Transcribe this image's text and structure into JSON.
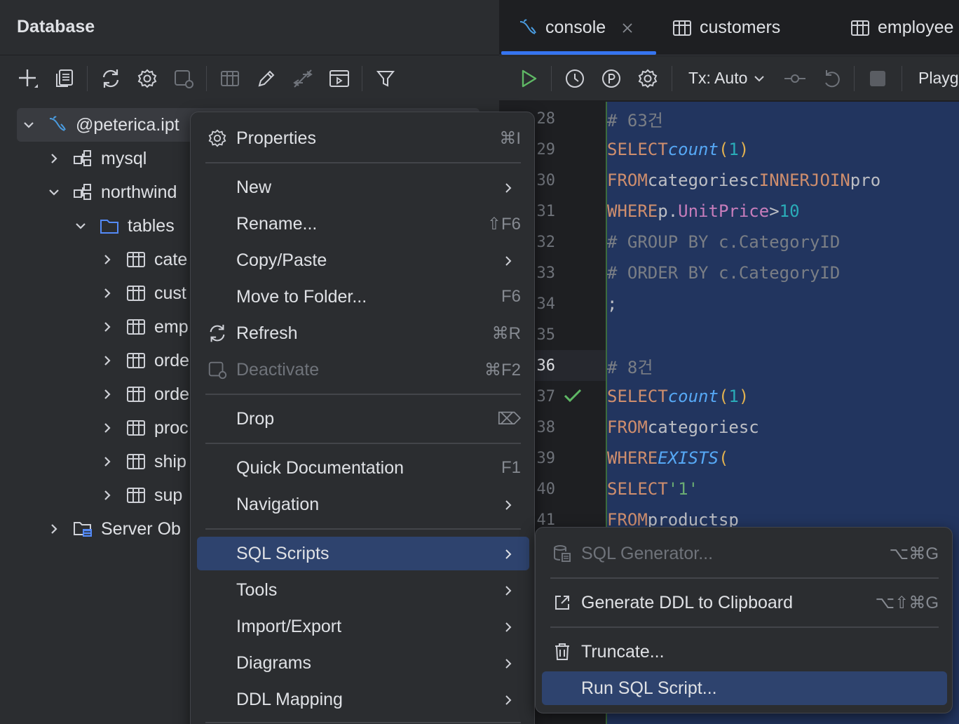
{
  "panel": {
    "title": "Database",
    "toolbar_icons": [
      "add-icon",
      "copy-icon",
      "refresh-icon",
      "settings-icon",
      "deactivate-icon",
      "table-icon",
      "edit-icon",
      "jump-icon",
      "console-icon",
      "filter-icon"
    ]
  },
  "tree": {
    "root": "@peterica.ipt",
    "items": [
      {
        "label": "mysql",
        "type": "schema",
        "expanded": false
      },
      {
        "label": "northwind",
        "type": "schema",
        "expanded": true
      },
      {
        "label": "tables",
        "type": "folder",
        "expanded": true
      },
      {
        "label": "cate",
        "type": "table"
      },
      {
        "label": "cust",
        "type": "table"
      },
      {
        "label": "emp",
        "type": "table"
      },
      {
        "label": "orde",
        "type": "table"
      },
      {
        "label": "orde",
        "type": "table"
      },
      {
        "label": "proc",
        "type": "table"
      },
      {
        "label": "ship",
        "type": "table"
      },
      {
        "label": "sup",
        "type": "table"
      },
      {
        "label": "Server Ob",
        "type": "server-objects",
        "expanded": false
      }
    ]
  },
  "tabs": [
    {
      "label": "console",
      "active": true
    },
    {
      "label": "customers",
      "active": false
    },
    {
      "label": "employee",
      "active": false
    }
  ],
  "editor_toolbar": {
    "tx": "Tx: Auto",
    "playground": "Playg"
  },
  "editor": {
    "current_line": "36",
    "lines": [
      {
        "n": "28",
        "text": "# 63건"
      },
      {
        "n": "29",
        "text": "SELECT count(1)"
      },
      {
        "n": "30",
        "text": "FROM categories c INNER JOIN pro"
      },
      {
        "n": "31",
        "text": "WHERE p.UnitPrice > 10"
      },
      {
        "n": "32",
        "text": "# GROUP BY c.CategoryID"
      },
      {
        "n": "33",
        "text": "# ORDER BY c.CategoryID"
      },
      {
        "n": "34",
        "text": ";"
      },
      {
        "n": "35",
        "text": ""
      },
      {
        "n": "36",
        "text": "# 8건"
      },
      {
        "n": "37",
        "text": "SELECT count(1)"
      },
      {
        "n": "38",
        "text": "FROM categories c"
      },
      {
        "n": "39",
        "text": "WHERE EXISTS ("
      },
      {
        "n": "40",
        "text": "        SELECT '1'"
      },
      {
        "n": "41",
        "text": "        FROM  products p"
      }
    ]
  },
  "context_menu": {
    "items": [
      {
        "label": "Properties",
        "shortcut": "⌘I",
        "icon": "gear-icon"
      },
      {
        "label": "New",
        "submenu": true
      },
      {
        "label": "Rename...",
        "shortcut": "⇧F6"
      },
      {
        "label": "Copy/Paste",
        "submenu": true
      },
      {
        "label": "Move to Folder...",
        "shortcut": "F6"
      },
      {
        "label": "Refresh",
        "shortcut": "⌘R",
        "icon": "refresh-icon"
      },
      {
        "label": "Deactivate",
        "shortcut": "⌘F2",
        "icon": "deactivate-icon",
        "disabled": true
      },
      {
        "label": "Drop",
        "shortcut": "⌦"
      },
      {
        "label": "Quick Documentation",
        "shortcut": "F1"
      },
      {
        "label": "Navigation",
        "submenu": true
      },
      {
        "label": "SQL Scripts",
        "submenu": true,
        "selected": true
      },
      {
        "label": "Tools",
        "submenu": true
      },
      {
        "label": "Import/Export",
        "submenu": true
      },
      {
        "label": "Diagrams",
        "submenu": true
      },
      {
        "label": "DDL Mapping",
        "submenu": true
      }
    ]
  },
  "submenu": {
    "items": [
      {
        "label": "SQL Generator...",
        "shortcut": "⌥⌘G",
        "icon": "sql-generator-icon",
        "disabled": true
      },
      {
        "label": "Generate DDL to Clipboard",
        "shortcut": "⌥⇧⌘G",
        "icon": "export-icon"
      },
      {
        "label": "Truncate...",
        "icon": "trash-icon"
      },
      {
        "label": "Run SQL Script...",
        "selected": true
      }
    ]
  },
  "colors": {
    "panel_bg": "#2b2d30",
    "editor_bg": "#1e1f22",
    "selection_bg": "#22355f",
    "menu_selected": "#2e436e",
    "accent": "#3574f0"
  }
}
